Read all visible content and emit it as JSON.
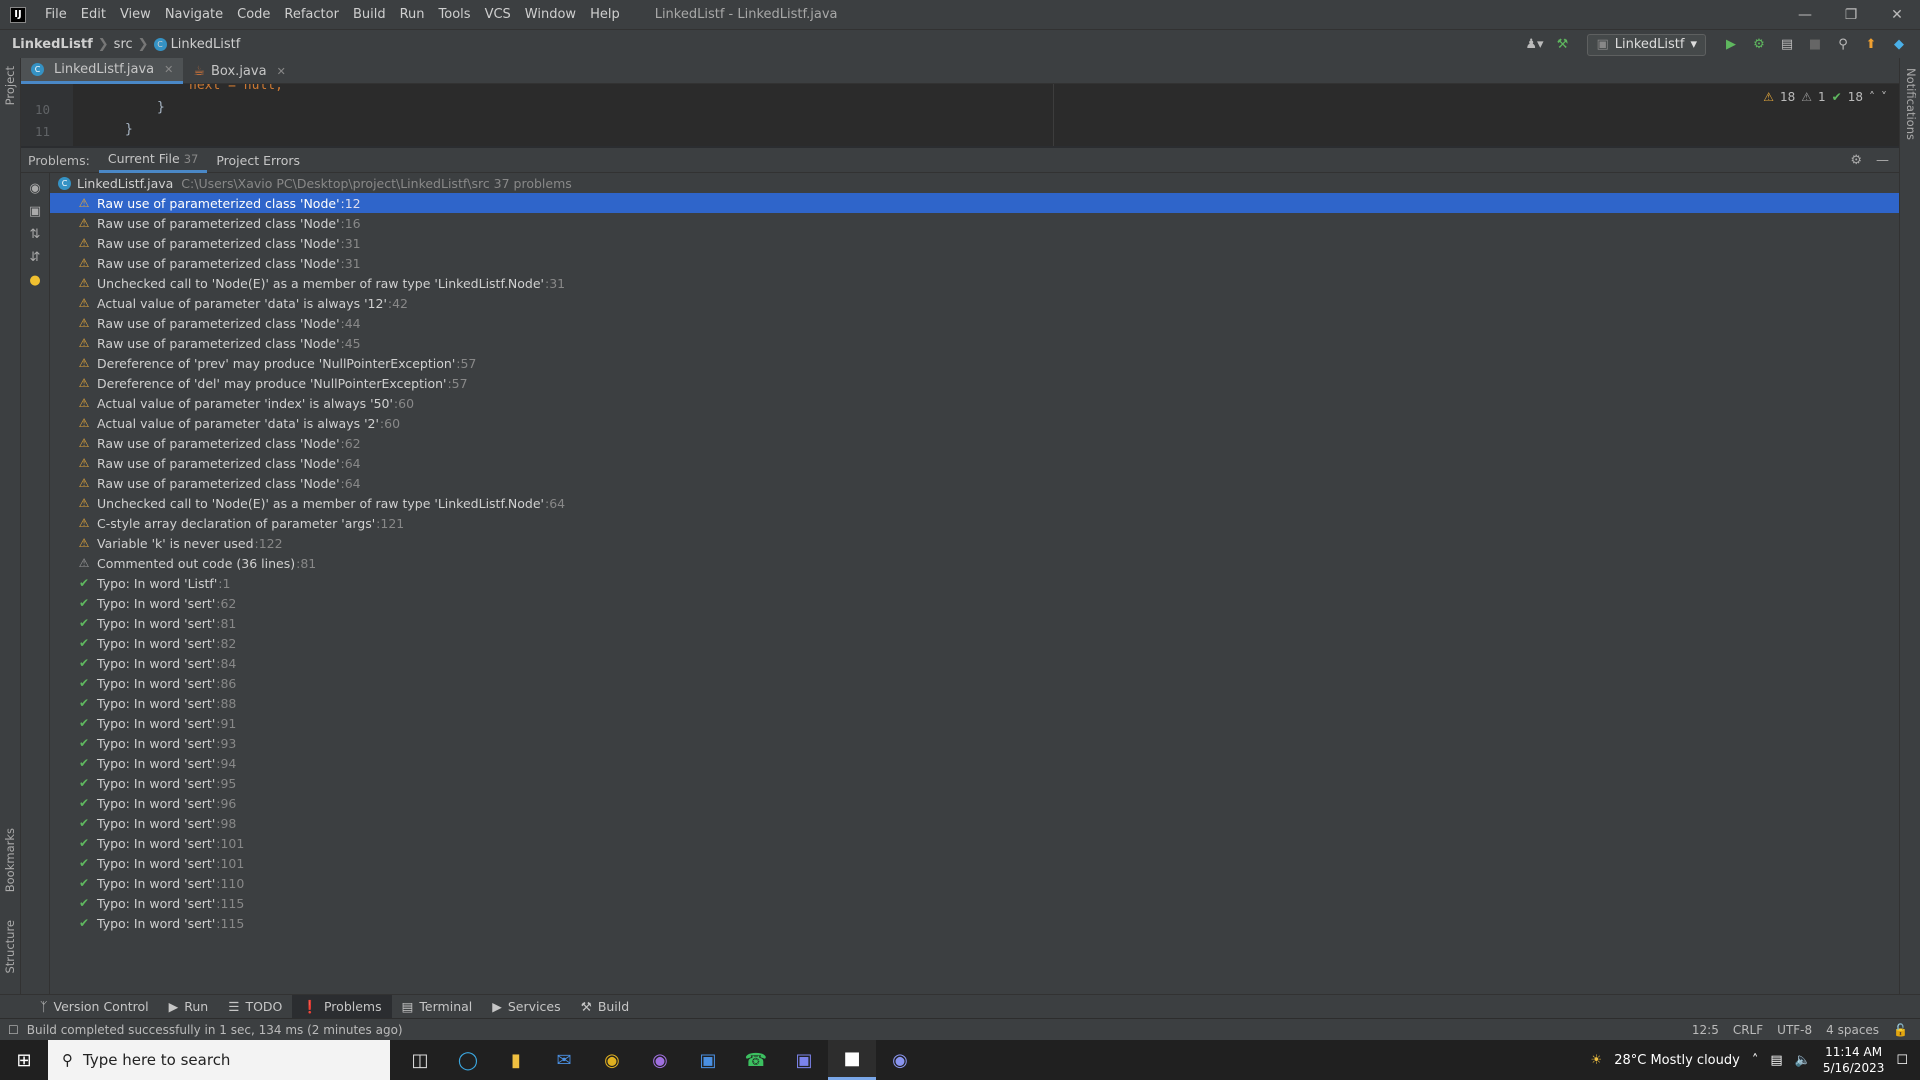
{
  "titlebar": {
    "logo": "IJ",
    "menu": [
      "File",
      "Edit",
      "View",
      "Navigate",
      "Code",
      "Refactor",
      "Build",
      "Run",
      "Tools",
      "VCS",
      "Window",
      "Help"
    ],
    "title": "LinkedListf - LinkedListf.java"
  },
  "navbar": {
    "crumbs": [
      "LinkedListf",
      "src",
      "LinkedListf"
    ],
    "run_config": "LinkedListf"
  },
  "left_strip": {
    "project": "Project",
    "bookmarks": "Bookmarks",
    "structure": "Structure"
  },
  "right_strip": {
    "notifications": "Notifications"
  },
  "tabs": [
    {
      "label": "LinkedListf.java",
      "icon": "class-icon"
    },
    {
      "label": "Box.java",
      "icon": "java-file-icon"
    }
  ],
  "editor": {
    "lines": [
      {
        "no": "",
        "text": "next = null;"
      },
      {
        "no": "10",
        "text": "}"
      },
      {
        "no": "11",
        "text": "}"
      }
    ],
    "highlights": {
      "warnings": "18",
      "weak": "1",
      "typos": "18"
    }
  },
  "problems": {
    "label": "Problems:",
    "tabs": [
      {
        "label": "Current File",
        "count": "37"
      },
      {
        "label": "Project Errors",
        "count": ""
      }
    ],
    "file": {
      "name": "LinkedListf.java",
      "path": "C:\\Users\\Xavio PC\\Desktop\\project\\LinkedListf\\src  37 problems"
    },
    "items": [
      {
        "type": "warn",
        "text": "Raw use of parameterized class 'Node'",
        "line": ":12",
        "selected": true
      },
      {
        "type": "warn",
        "text": "Raw use of parameterized class 'Node'",
        "line": ":16"
      },
      {
        "type": "warn",
        "text": "Raw use of parameterized class 'Node'",
        "line": ":31"
      },
      {
        "type": "warn",
        "text": "Raw use of parameterized class 'Node'",
        "line": ":31"
      },
      {
        "type": "warn",
        "text": "Unchecked call to 'Node(E)' as a member of raw type 'LinkedListf.Node'",
        "line": ":31"
      },
      {
        "type": "warn",
        "text": "Actual value of parameter 'data' is always '12'",
        "line": ":42"
      },
      {
        "type": "warn",
        "text": "Raw use of parameterized class 'Node'",
        "line": ":44"
      },
      {
        "type": "warn",
        "text": "Raw use of parameterized class 'Node'",
        "line": ":45"
      },
      {
        "type": "warn",
        "text": "Dereference of 'prev' may produce 'NullPointerException'",
        "line": ":57"
      },
      {
        "type": "warn",
        "text": "Dereference of 'del' may produce 'NullPointerException'",
        "line": ":57"
      },
      {
        "type": "warn",
        "text": "Actual value of parameter 'index' is always '50'",
        "line": ":60"
      },
      {
        "type": "warn",
        "text": "Actual value of parameter 'data' is always '2'",
        "line": ":60"
      },
      {
        "type": "warn",
        "text": "Raw use of parameterized class 'Node'",
        "line": ":62"
      },
      {
        "type": "warn",
        "text": "Raw use of parameterized class 'Node'",
        "line": ":64"
      },
      {
        "type": "warn",
        "text": "Raw use of parameterized class 'Node'",
        "line": ":64"
      },
      {
        "type": "warn",
        "text": "Unchecked call to 'Node(E)' as a member of raw type 'LinkedListf.Node'",
        "line": ":64"
      },
      {
        "type": "warn",
        "text": "C-style array declaration of parameter 'args'",
        "line": ":121"
      },
      {
        "type": "warn",
        "text": "Variable 'k' is never used",
        "line": ":122"
      },
      {
        "type": "weak",
        "text": "Commented out code (36 lines)",
        "line": ":81"
      },
      {
        "type": "typo",
        "text": "Typo: In word 'Listf'",
        "line": ":1"
      },
      {
        "type": "typo",
        "text": "Typo: In word 'sert'",
        "line": ":62"
      },
      {
        "type": "typo",
        "text": "Typo: In word 'sert'",
        "line": ":81"
      },
      {
        "type": "typo",
        "text": "Typo: In word 'sert'",
        "line": ":82"
      },
      {
        "type": "typo",
        "text": "Typo: In word 'sert'",
        "line": ":84"
      },
      {
        "type": "typo",
        "text": "Typo: In word 'sert'",
        "line": ":86"
      },
      {
        "type": "typo",
        "text": "Typo: In word 'sert'",
        "line": ":88"
      },
      {
        "type": "typo",
        "text": "Typo: In word 'sert'",
        "line": ":91"
      },
      {
        "type": "typo",
        "text": "Typo: In word 'sert'",
        "line": ":93"
      },
      {
        "type": "typo",
        "text": "Typo: In word 'sert'",
        "line": ":94"
      },
      {
        "type": "typo",
        "text": "Typo: In word 'sert'",
        "line": ":95"
      },
      {
        "type": "typo",
        "text": "Typo: In word 'sert'",
        "line": ":96"
      },
      {
        "type": "typo",
        "text": "Typo: In word 'sert'",
        "line": ":98"
      },
      {
        "type": "typo",
        "text": "Typo: In word 'sert'",
        "line": ":101"
      },
      {
        "type": "typo",
        "text": "Typo: In word 'sert'",
        "line": ":101"
      },
      {
        "type": "typo",
        "text": "Typo: In word 'sert'",
        "line": ":110"
      },
      {
        "type": "typo",
        "text": "Typo: In word 'sert'",
        "line": ":115"
      },
      {
        "type": "typo",
        "text": "Typo: In word 'sert'",
        "line": ":115"
      }
    ]
  },
  "bottom_tools": [
    {
      "label": "Version Control",
      "icon": "vcs-branch-icon"
    },
    {
      "label": "Run",
      "icon": "run-icon"
    },
    {
      "label": "TODO",
      "icon": "todo-list-icon"
    },
    {
      "label": "Problems",
      "icon": "problems-icon",
      "active": true
    },
    {
      "label": "Terminal",
      "icon": "terminal-icon"
    },
    {
      "label": "Services",
      "icon": "services-icon"
    },
    {
      "label": "Build",
      "icon": "hammer-icon"
    }
  ],
  "status": {
    "message": "Build completed successfully in 1 sec, 134 ms (2 minutes ago)",
    "position": "12:5",
    "line_sep": "CRLF",
    "encoding": "UTF-8",
    "indent": "4 spaces"
  },
  "taskbar": {
    "search_placeholder": "Type here to search",
    "weather": "28°C  Mostly cloudy",
    "time": "11:14 AM",
    "date": "5/16/2023"
  },
  "colors": {
    "accent": "#2f65ca",
    "warning": "#e2a63b",
    "typo": "#5fb85f"
  }
}
